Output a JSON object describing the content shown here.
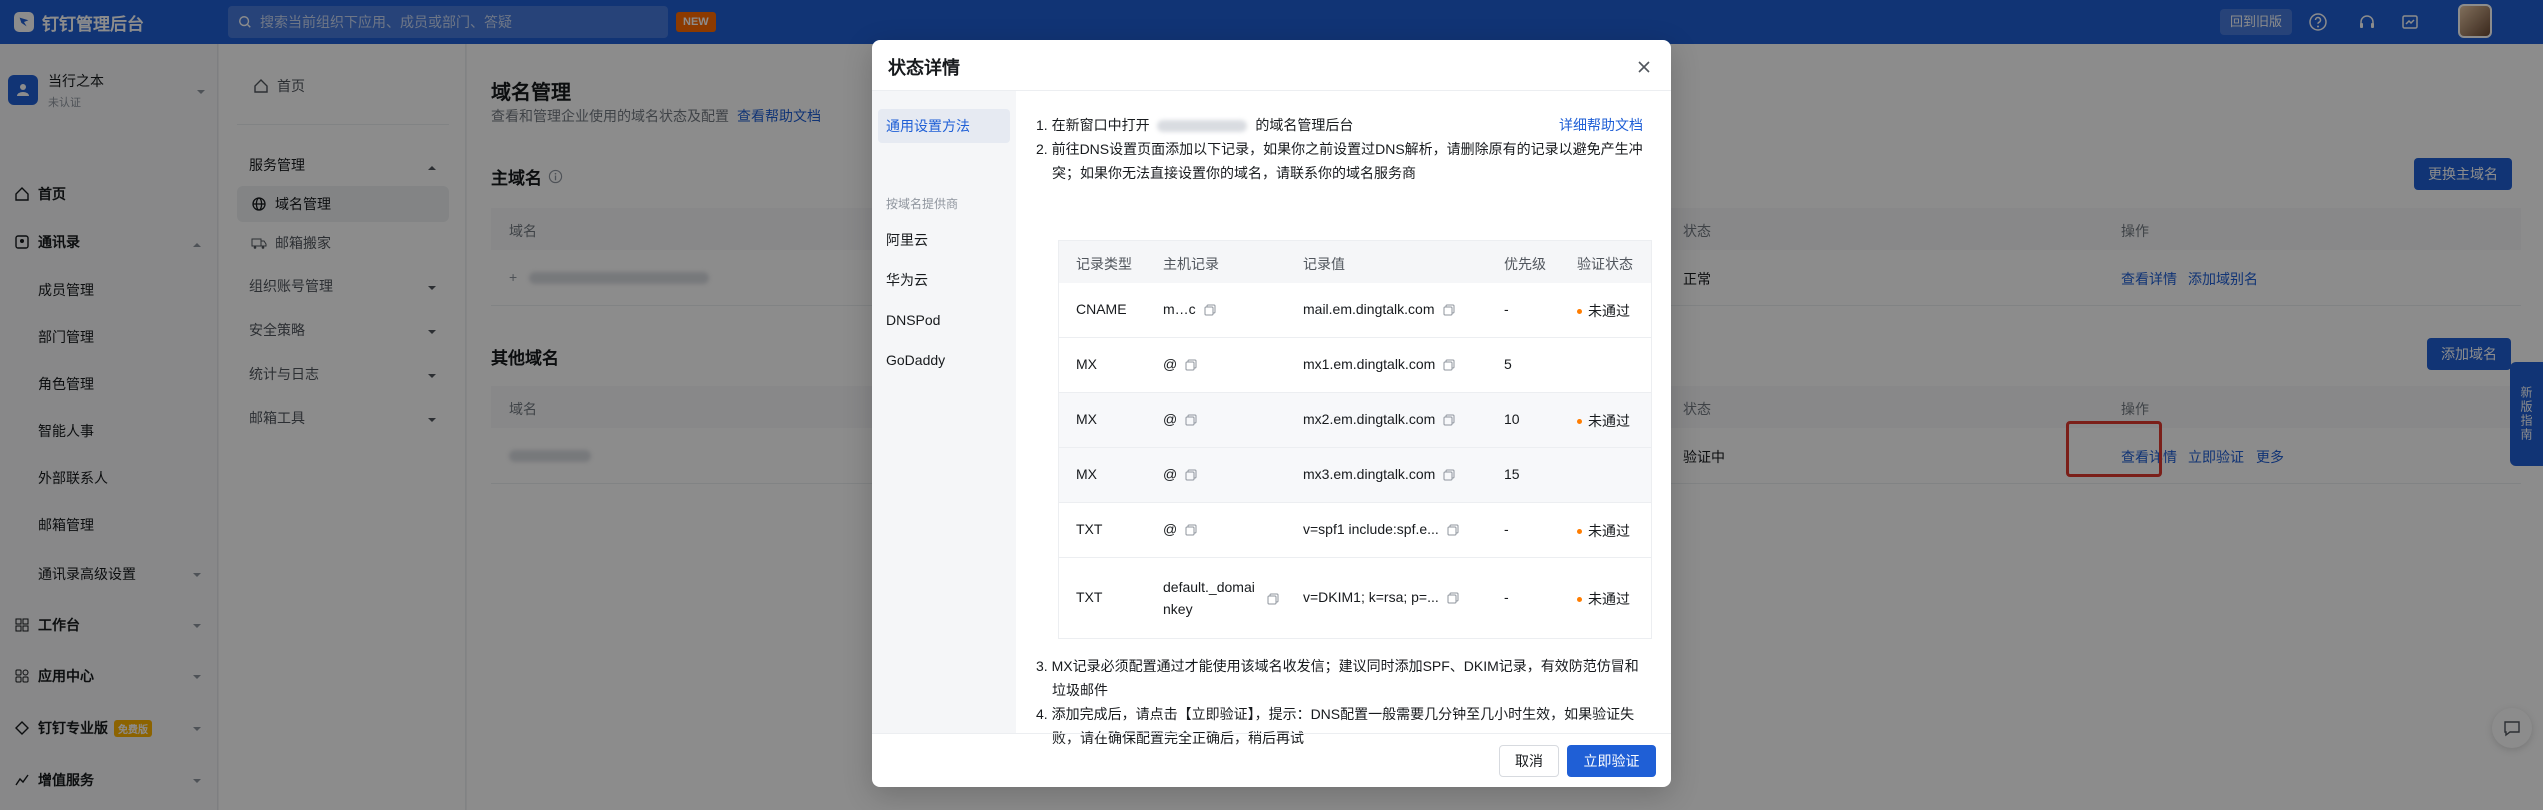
{
  "topbar": {
    "app_title": "钉钉管理后台",
    "search_placeholder": "搜索当前组织下应用、成员或部门、答疑",
    "new_badge": "NEW",
    "old_version": "回到旧版"
  },
  "org": {
    "name": "当行之本",
    "status": "未认证"
  },
  "sidebar": {
    "items": [
      {
        "label": "首页",
        "icon": "home-icon"
      },
      {
        "label": "通讯录",
        "icon": "contacts-icon"
      },
      {
        "label": "成员管理"
      },
      {
        "label": "部门管理"
      },
      {
        "label": "角色管理"
      },
      {
        "label": "智能人事"
      },
      {
        "label": "外部联系人"
      },
      {
        "label": "邮箱管理"
      },
      {
        "label": "通讯录高级设置"
      },
      {
        "label": "工作台",
        "icon": "grid-icon"
      },
      {
        "label": "应用中心",
        "icon": "apps-icon"
      },
      {
        "label": "钉钉专业版",
        "icon": "diamond-icon",
        "badge": "免费版"
      },
      {
        "label": "增值服务",
        "icon": "service-icon"
      }
    ]
  },
  "subnav": {
    "home": "首页",
    "group": "服务管理",
    "items": [
      "域名管理",
      "邮箱搬家"
    ],
    "others": [
      "组织账号管理",
      "安全策略",
      "统计与日志",
      "邮箱工具"
    ]
  },
  "main": {
    "title": "域名管理",
    "desc": "查看和管理企业使用的域名状态及配置",
    "help_link": "查看帮助文档",
    "primary": {
      "title": "主域名",
      "button": "更换主域名",
      "col_domain": "域名",
      "col_status": "状态",
      "col_action": "操作",
      "row_status": "正常",
      "row_action1": "查看详情",
      "row_action2": "添加域别名"
    },
    "other": {
      "title": "其他域名",
      "button": "添加域名",
      "col_domain": "域名",
      "col_status": "状态",
      "col_action": "操作",
      "row_status": "验证中",
      "row_action1": "查看详情",
      "row_action2": "立即验证",
      "row_action3": "更多"
    },
    "side_guide": "新版指南"
  },
  "modal": {
    "title": "状态详情",
    "left_active": "通用设置方法",
    "left_label": "按域名提供商",
    "providers": [
      "阿里云",
      "华为云",
      "DNSPod",
      "GoDaddy"
    ],
    "step1_prefix": "1. 在新窗口中打开",
    "step1_suffix": "的域名管理后台",
    "help_doc": "详细帮助文档",
    "step2_line1": "2. 前往DNS设置页面添加以下记录，如果你之前设置过DNS解析，请删除原有的记录以避免产生冲",
    "step2_line2": "突；如果你无法直接设置你的域名，请联系你的域名服务商",
    "table": {
      "headers": [
        "记录类型",
        "主机记录",
        "记录值",
        "优先级",
        "验证状态"
      ],
      "rows": [
        {
          "type": "CNAME",
          "host": "m…c",
          "value": "mail.em.dingtalk.com",
          "priority": "-",
          "status": "未通过"
        },
        {
          "type": "MX",
          "host": "@",
          "value": "mx1.em.dingtalk.com",
          "priority": "5",
          "status": ""
        },
        {
          "type": "MX",
          "host": "@",
          "value": "mx2.em.dingtalk.com",
          "priority": "10",
          "status": "未通过"
        },
        {
          "type": "MX",
          "host": "@",
          "value": "mx3.em.dingtalk.com",
          "priority": "15",
          "status": ""
        },
        {
          "type": "TXT",
          "host": "@",
          "value": "v=spf1 include:spf.e...",
          "priority": "-",
          "status": "未通过"
        },
        {
          "type": "TXT",
          "host": "default._domainkey",
          "value": "v=DKIM1; k=rsa; p=...",
          "priority": "-",
          "status": "未通过"
        }
      ]
    },
    "step3_line1": "3. MX记录必须配置通过才能使用该域名收发信；建议同时添加SPF、DKIM记录，有效防范仿冒和",
    "step3_line2": "垃圾邮件",
    "step4_line1": "4. 添加完成后，请点击【立即验证】，提示：DNS配置一般需要几分钟至几小时生效，如果验证失",
    "step4_line2": "败，请在确保配置完全正确后，稍后再试",
    "cancel": "取消",
    "verify": "立即验证"
  },
  "colors": {
    "brand": "#1f5fd6",
    "warn": "#ff7d00",
    "highlight": "#e03a2f"
  }
}
